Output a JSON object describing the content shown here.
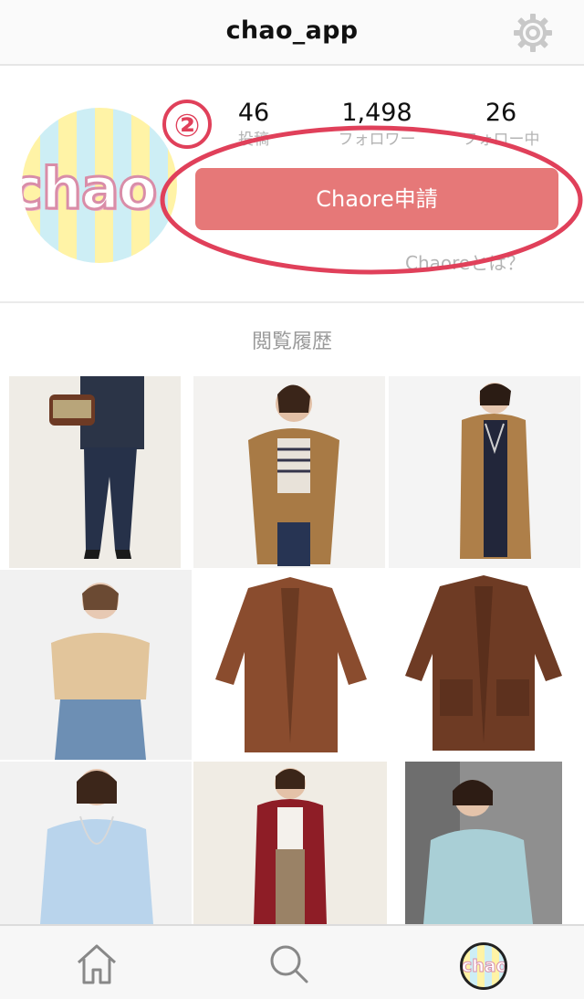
{
  "header": {
    "title": "chao_app",
    "settings_icon": "gear-icon"
  },
  "profile": {
    "avatar_text": "chao",
    "step_marker": "②",
    "stats": [
      {
        "value": "46",
        "label": "投稿"
      },
      {
        "value": "1,498",
        "label": "フォロワー"
      },
      {
        "value": "26",
        "label": "フォロー中"
      }
    ],
    "cta_label": "Chaore申請",
    "what_is_link": "Chaoreとは？",
    "annotation_color": "#e0405a",
    "cta_color": "#e67878"
  },
  "history": {
    "title": "閲覧履歴",
    "items": [
      {
        "icon": "woman-handbag-navy-pants-photo"
      },
      {
        "icon": "woman-camel-coat-photo"
      },
      {
        "icon": "woman-camel-long-cardigan-photo"
      },
      {
        "icon": "woman-beige-sweater-photo"
      },
      {
        "icon": "brown-cardigan-photo"
      },
      {
        "icon": "brown-pocket-cardigan-photo"
      },
      {
        "icon": "woman-light-blue-sweater-photo"
      },
      {
        "icon": "woman-red-cardigan-photo"
      },
      {
        "icon": "woman-mint-fluffy-sweater-photo"
      }
    ]
  },
  "tabbar": {
    "tabs": [
      {
        "icon": "home-icon"
      },
      {
        "icon": "search-icon"
      },
      {
        "icon": "profile-avatar-icon",
        "text": "chao"
      }
    ]
  }
}
